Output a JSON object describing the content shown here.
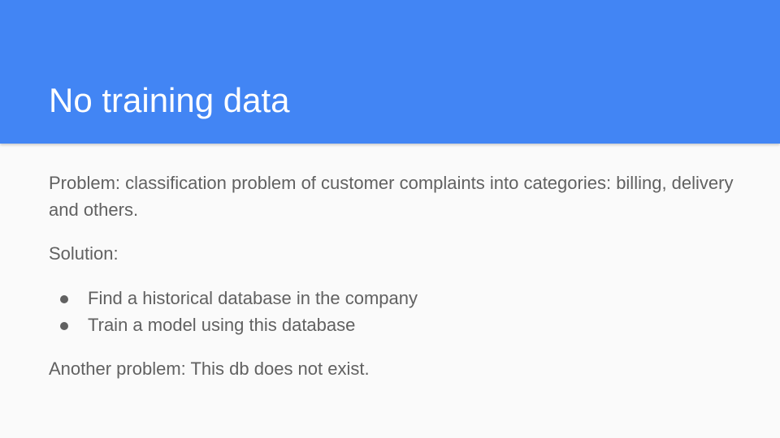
{
  "slide": {
    "title": "No training data",
    "problem": "Problem: classification problem of customer complaints into categories: billing, delivery and others.",
    "solution_label": "Solution:",
    "bullets": [
      "Find a historical database in the company",
      "Train a model using this database"
    ],
    "another_problem": "Another problem: This db does not exist."
  },
  "colors": {
    "header_bg": "#4285f4",
    "slide_bg": "#fafafa",
    "title_text": "#ffffff",
    "body_text": "#616161"
  }
}
